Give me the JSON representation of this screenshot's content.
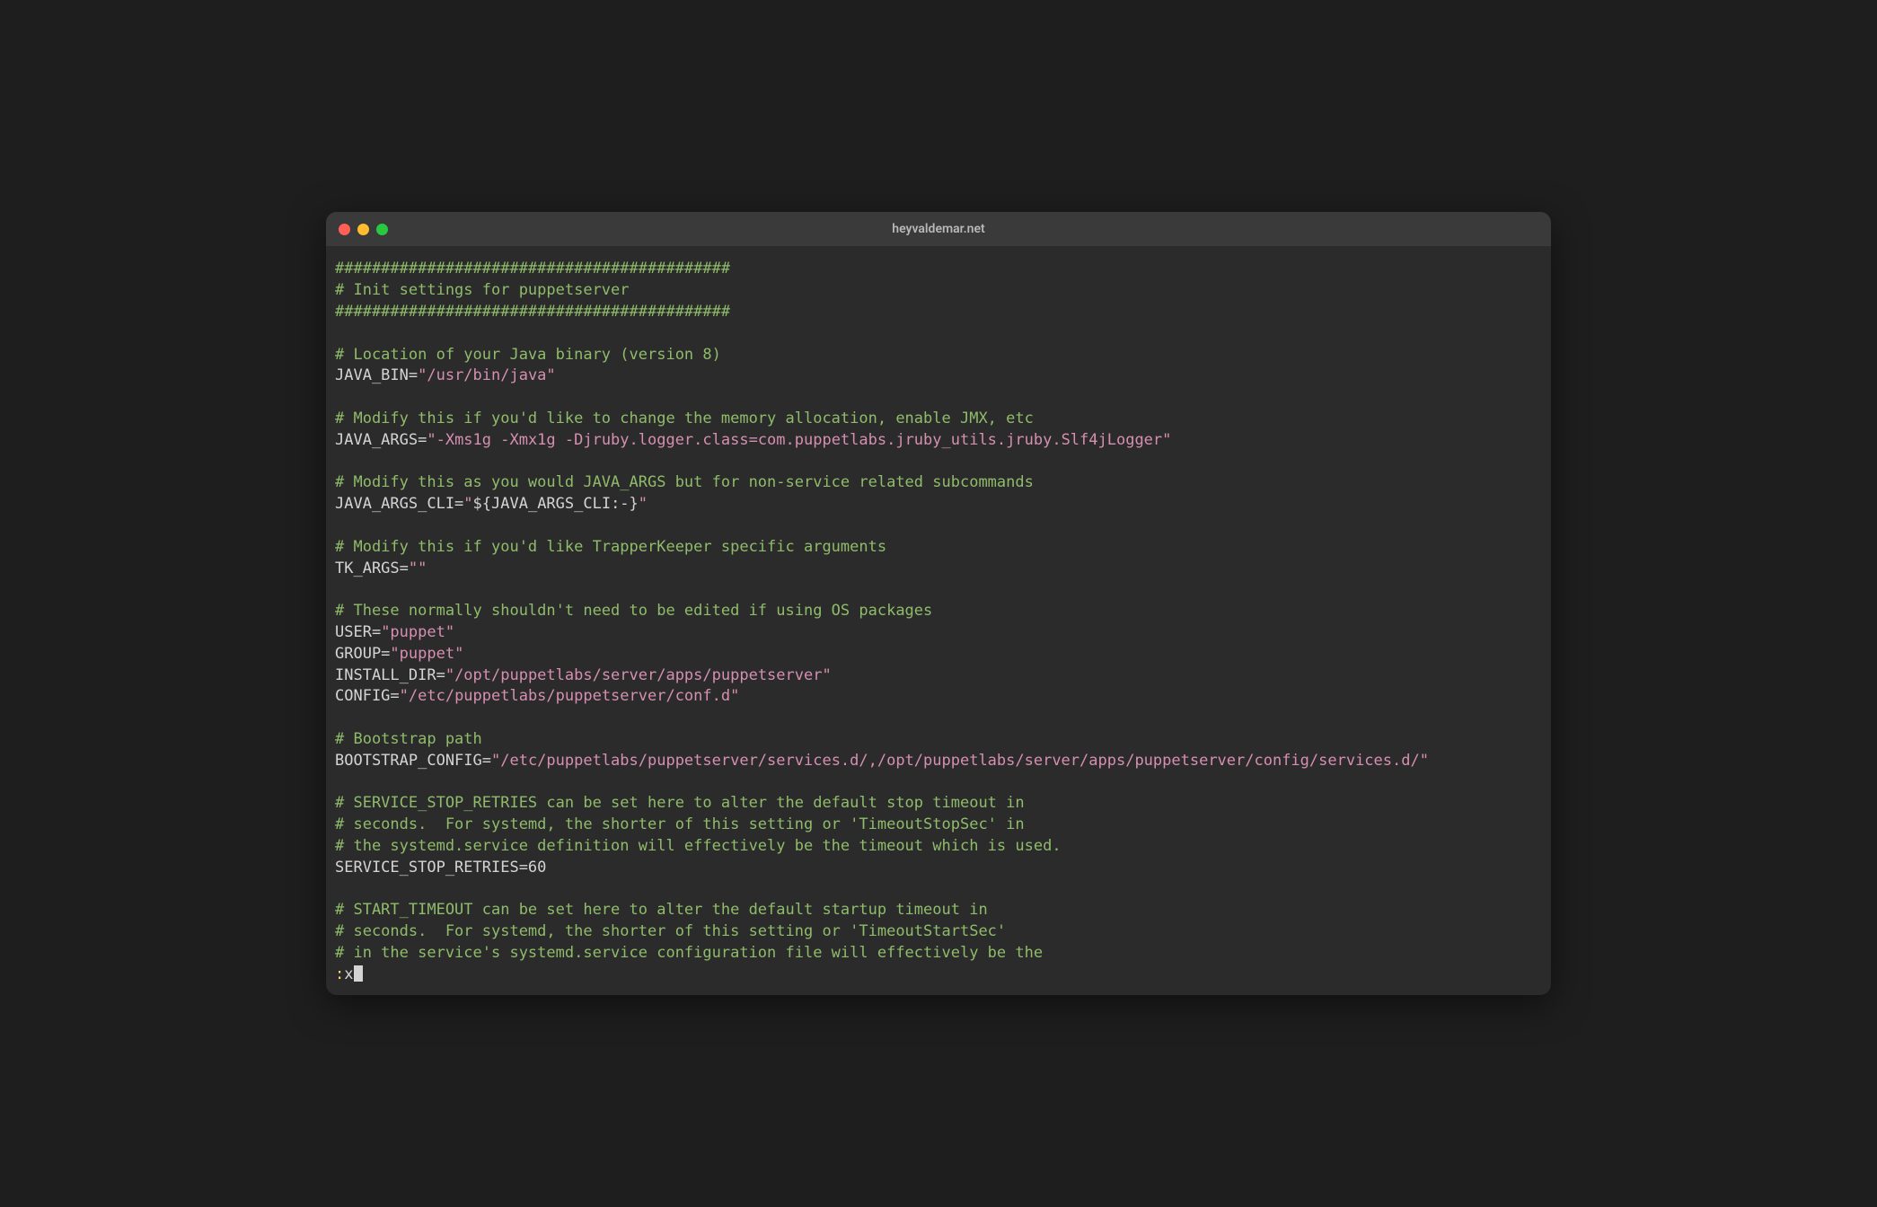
{
  "titlebar": {
    "title": "heyvaldemar.net"
  },
  "lines": {
    "l0": "###########################################",
    "l1": "# Init settings for puppetserver",
    "l2": "###########################################",
    "l3": "# Location of your Java binary (version 8)",
    "l4a": "JAVA_BIN=",
    "l4b": "\"/usr/bin/java\"",
    "l5": "# Modify this if you'd like to change the memory allocation, enable JMX, etc",
    "l6a": "JAVA_ARGS=",
    "l6b": "\"-Xms1g -Xmx1g -Djruby.logger.class=com.puppetlabs.jruby_utils.jruby.Slf4jLogger\"",
    "l7": "# Modify this as you would JAVA_ARGS but for non-service related subcommands",
    "l8a": "JAVA_ARGS_CLI=",
    "l8b": "\"",
    "l8c": "${JAVA_ARGS_CLI:-}",
    "l8d": "\"",
    "l9": "# Modify this if you'd like TrapperKeeper specific arguments",
    "l10a": "TK_ARGS=",
    "l10b": "\"\"",
    "l11": "# These normally shouldn't need to be edited if using OS packages",
    "l12a": "USER=",
    "l12b": "\"puppet\"",
    "l13a": "GROUP=",
    "l13b": "\"puppet\"",
    "l14a": "INSTALL_DIR=",
    "l14b": "\"/opt/puppetlabs/server/apps/puppetserver\"",
    "l15a": "CONFIG=",
    "l15b": "\"/etc/puppetlabs/puppetserver/conf.d\"",
    "l16": "# Bootstrap path",
    "l17a": "BOOTSTRAP_CONFIG=",
    "l17b": "\"/etc/puppetlabs/puppetserver/services.d/,/opt/puppetlabs/server/apps/puppetserver/config/services.d/\"",
    "l18": "# SERVICE_STOP_RETRIES can be set here to alter the default stop timeout in",
    "l19": "# seconds.  For systemd, the shorter of this setting or 'TimeoutStopSec' in",
    "l20": "# the systemd.service definition will effectively be the timeout which is used.",
    "l21": "SERVICE_STOP_RETRIES=60",
    "l22": "# START_TIMEOUT can be set here to alter the default startup timeout in",
    "l23": "# seconds.  For systemd, the shorter of this setting or 'TimeoutStartSec'",
    "l24": "# in the service's systemd.service configuration file will effectively be the",
    "cmdprefix": ":",
    "cmd": "x"
  }
}
